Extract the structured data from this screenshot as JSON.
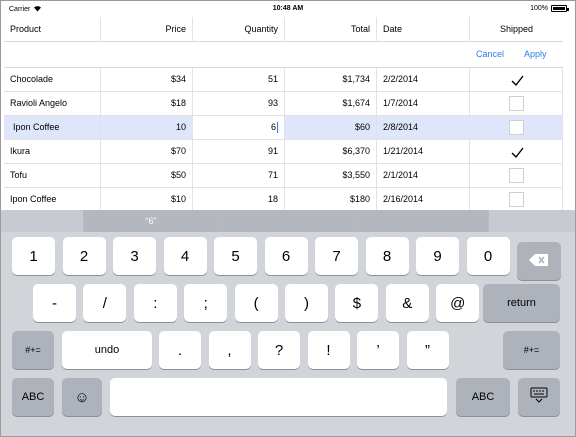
{
  "status": {
    "carrier": "Carrier",
    "time": "10:48 AM",
    "battery": "100%"
  },
  "grid": {
    "columns": [
      "Product",
      "Price",
      "Quantity",
      "Total",
      "Date",
      "Shipped"
    ],
    "actions": {
      "cancel": "Cancel",
      "apply": "Apply"
    },
    "rows": [
      {
        "product": "Chocolade",
        "price": "$34",
        "quantity": "51",
        "total": "$1,734",
        "date": "2/2/2014",
        "shipped": true
      },
      {
        "product": "Ravioli Angelo",
        "price": "$18",
        "quantity": "93",
        "total": "$1,674",
        "date": "1/7/2014",
        "shipped": false
      },
      {
        "product": "Ipon Coffee",
        "price": "10",
        "quantity": "6",
        "total": "$60",
        "date": "2/8/2014",
        "shipped": false
      },
      {
        "product": "Ikura",
        "price": "$70",
        "quantity": "91",
        "total": "$6,370",
        "date": "1/21/2014",
        "shipped": true
      },
      {
        "product": "Tofu",
        "price": "$50",
        "quantity": "71",
        "total": "$3,550",
        "date": "2/1/2014",
        "shipped": false
      },
      {
        "product": "Ipon Coffee",
        "price": "$10",
        "quantity": "18",
        "total": "$180",
        "date": "2/16/2014",
        "shipped": false
      }
    ]
  },
  "suggestion": {
    "middle": "“6”"
  },
  "keyboard": {
    "row1": [
      "1",
      "2",
      "3",
      "4",
      "5",
      "6",
      "7",
      "8",
      "9",
      "0"
    ],
    "row2": [
      "-",
      "/",
      ":",
      ";",
      "(",
      ")",
      "$",
      "&",
      "@"
    ],
    "return_label": "return",
    "symbols_label": "#+=",
    "undo_label": "undo",
    "row3": [
      ".",
      ",",
      "?",
      "!",
      "’",
      "”"
    ],
    "abc_label": "ABC",
    "emoji_glyph": "☺"
  }
}
